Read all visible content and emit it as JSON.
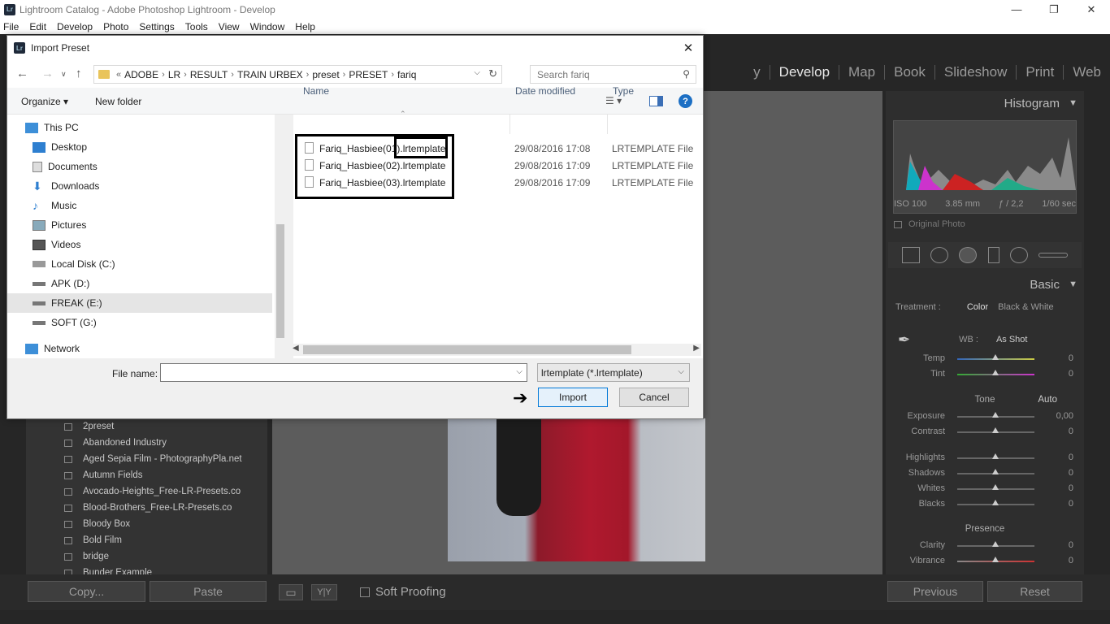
{
  "window": {
    "title": "Lightroom Catalog - Adobe Photoshop Lightroom - Develop",
    "logo": "Lr"
  },
  "menu": [
    "File",
    "Edit",
    "Develop",
    "Photo",
    "Settings",
    "Tools",
    "View",
    "Window",
    "Help"
  ],
  "modules": [
    "y",
    "Develop",
    "Map",
    "Book",
    "Slideshow",
    "Print",
    "Web"
  ],
  "presets": [
    "2preset",
    "Abandoned Industry",
    "Aged Sepia Film - PhotographyPla.net",
    "Autumn Fields",
    "Avocado-Heights_Free-LR-Presets.co",
    "Blood-Brothers_Free-LR-Presets.co",
    "Bloody Box",
    "Bold Film",
    "bridge",
    "Bunder Example"
  ],
  "bottom": {
    "copy": "Copy...",
    "paste": "Paste",
    "soft_proofing": "Soft Proofing",
    "previous": "Previous",
    "reset": "Reset",
    "yy": "Y|Y"
  },
  "right_panel": {
    "histogram": "Histogram",
    "iso": "ISO 100",
    "focal": "3.85 mm",
    "aperture": "ƒ / 2,2",
    "shutter": "1/60 sec",
    "original_photo": "Original Photo",
    "basic": "Basic",
    "treatment": "Treatment :",
    "color": "Color",
    "bw": "Black & White",
    "wb_label": "WB :",
    "wb_value": "As Shot",
    "tone": "Tone",
    "auto": "Auto",
    "presence": "Presence",
    "sliders": [
      {
        "label": "Temp",
        "value": "0"
      },
      {
        "label": "Tint",
        "value": "0"
      },
      {
        "label": "Exposure",
        "value": "0,00"
      },
      {
        "label": "Contrast",
        "value": "0"
      },
      {
        "label": "Highlights",
        "value": "0"
      },
      {
        "label": "Shadows",
        "value": "0"
      },
      {
        "label": "Whites",
        "value": "0"
      },
      {
        "label": "Blacks",
        "value": "0"
      },
      {
        "label": "Clarity",
        "value": "0"
      },
      {
        "label": "Vibrance",
        "value": "0"
      }
    ]
  },
  "dialog": {
    "title": "Import Preset",
    "logo": "Lr",
    "breadcrumb": [
      "ADOBE",
      "LR",
      "RESULT",
      "TRAIN URBEX",
      "preset",
      "PRESET",
      "fariq"
    ],
    "search_placeholder": "Search fariq",
    "organize": "Organize",
    "new_folder": "New folder",
    "nav": [
      "This PC",
      "Desktop",
      "Documents",
      "Downloads",
      "Music",
      "Pictures",
      "Videos",
      "Local Disk (C:)",
      "APK (D:)",
      "FREAK (E:)",
      "SOFT (G:)",
      "Network"
    ],
    "columns": {
      "name": "Name",
      "date": "Date modified",
      "type": "Type"
    },
    "files": [
      {
        "name": "Fariq_Hasbiee(01).lrtemplate",
        "date": "29/08/2016 17:08",
        "type": "LRTEMPLATE File"
      },
      {
        "name": "Fariq_Hasbiee(02).lrtemplate",
        "date": "29/08/2016 17:09",
        "type": "LRTEMPLATE File"
      },
      {
        "name": "Fariq_Hasbiee(03).lrtemplate",
        "date": "29/08/2016 17:09",
        "type": "LRTEMPLATE File"
      }
    ],
    "file_name_label": "File name:",
    "file_name_value": "",
    "file_type": "lrtemplate (*.lrtemplate)",
    "import": "Import",
    "cancel": "Cancel"
  }
}
